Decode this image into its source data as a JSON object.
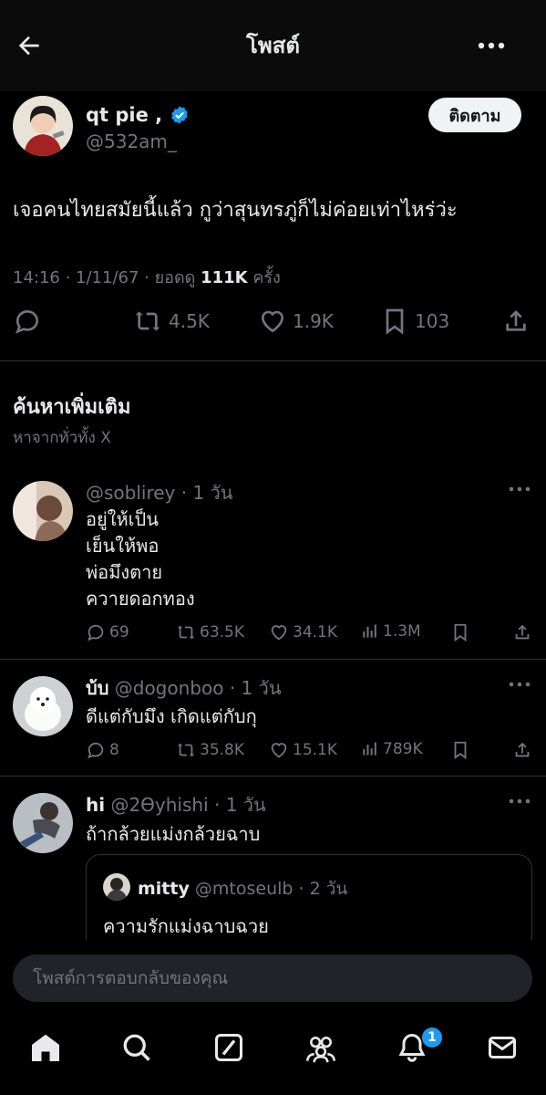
{
  "header": {
    "title": "โพสต์"
  },
  "post": {
    "author_name": "qt pie ,",
    "handle": "@532am_",
    "follow_label": "ติดตาม",
    "text": "เจอคนไทยสมัยนี้แล้ว กูว่าสุนทรภู่ก็ไม่ค่อยเท่าไหร่ว่ะ",
    "meta_prefix": "14:16 · 1/11/67 · ยอดดู ",
    "views": "111K",
    "views_suffix": " ครั้ง",
    "retweets": "4.5K",
    "likes": "1.9K",
    "bookmarks": "103"
  },
  "discover": {
    "title": "ค้นหาเพิ่มเติม",
    "subtitle": "หาจากทั่วทั้ง X"
  },
  "replies": [
    {
      "name": "",
      "handle": "@soblirey",
      "time": "· 1 วัน",
      "lines": [
        "อยู่ให้เป็น",
        "เย็นให้พอ",
        "พ่อมึงตาย",
        "ควายดอกทอง"
      ],
      "replies": "69",
      "retweets": "63.5K",
      "likes": "34.1K",
      "views": "1.3M"
    },
    {
      "name": "บ้บ",
      "handle": "@dogonboo",
      "time": "· 1 วัน",
      "lines": [
        "ดีแต่กับมึง เกิดแต่กับกุ"
      ],
      "replies": "8",
      "retweets": "35.8K",
      "likes": "15.1K",
      "views": "789K"
    },
    {
      "name": "hi",
      "handle": "@2Ɵyhishi",
      "time": "· 1 วัน",
      "lines": [
        "ถ้ากล้วยแม่งกล้วยฉาบ"
      ],
      "quote": {
        "name": "mitty",
        "handle": "@mtoseulb",
        "time": "· 2 วัน",
        "text": "ความรักแม่งฉาบฉวย"
      }
    }
  ],
  "composer": {
    "placeholder": "โพสต์การตอบกลับของคุณ"
  },
  "nav": {
    "notifications_badge": "1"
  },
  "colors": {
    "background": "#000000",
    "accent": "#1d9bf0",
    "muted": "#71767b"
  }
}
